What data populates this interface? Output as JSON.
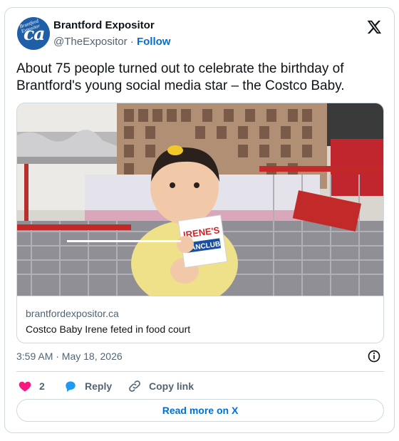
{
  "account": {
    "display_name": "Brantford Expositor",
    "handle": "@TheExpositor",
    "separator": "·",
    "follow_label": "Follow",
    "avatar_text": "ca",
    "avatar_masthead": "Brantford Expositor"
  },
  "platform_icon": "x-logo-icon",
  "tweet": {
    "text": "About 75 people turned out to celebrate the birthday of Brantford's young social media star – the Costco Baby."
  },
  "link_card": {
    "domain": "brantfordexpositor.ca",
    "title": "Costco Baby Irene feted in food court",
    "image_sign_top": "IRENE'S",
    "image_sign_bottom": "FANCLUB"
  },
  "meta": {
    "timestamp": "3:59 AM · May 18, 2026",
    "info_icon": "info-icon"
  },
  "actions": {
    "like_count": "2",
    "reply_label": "Reply",
    "copy_label": "Copy link"
  },
  "read_more_label": "Read more on X",
  "colors": {
    "link_blue": "#006fd6",
    "like_pink": "#f91880",
    "reply_blue": "#1d9bf0",
    "border": "#cfd9de",
    "secondary_text": "#536471"
  }
}
